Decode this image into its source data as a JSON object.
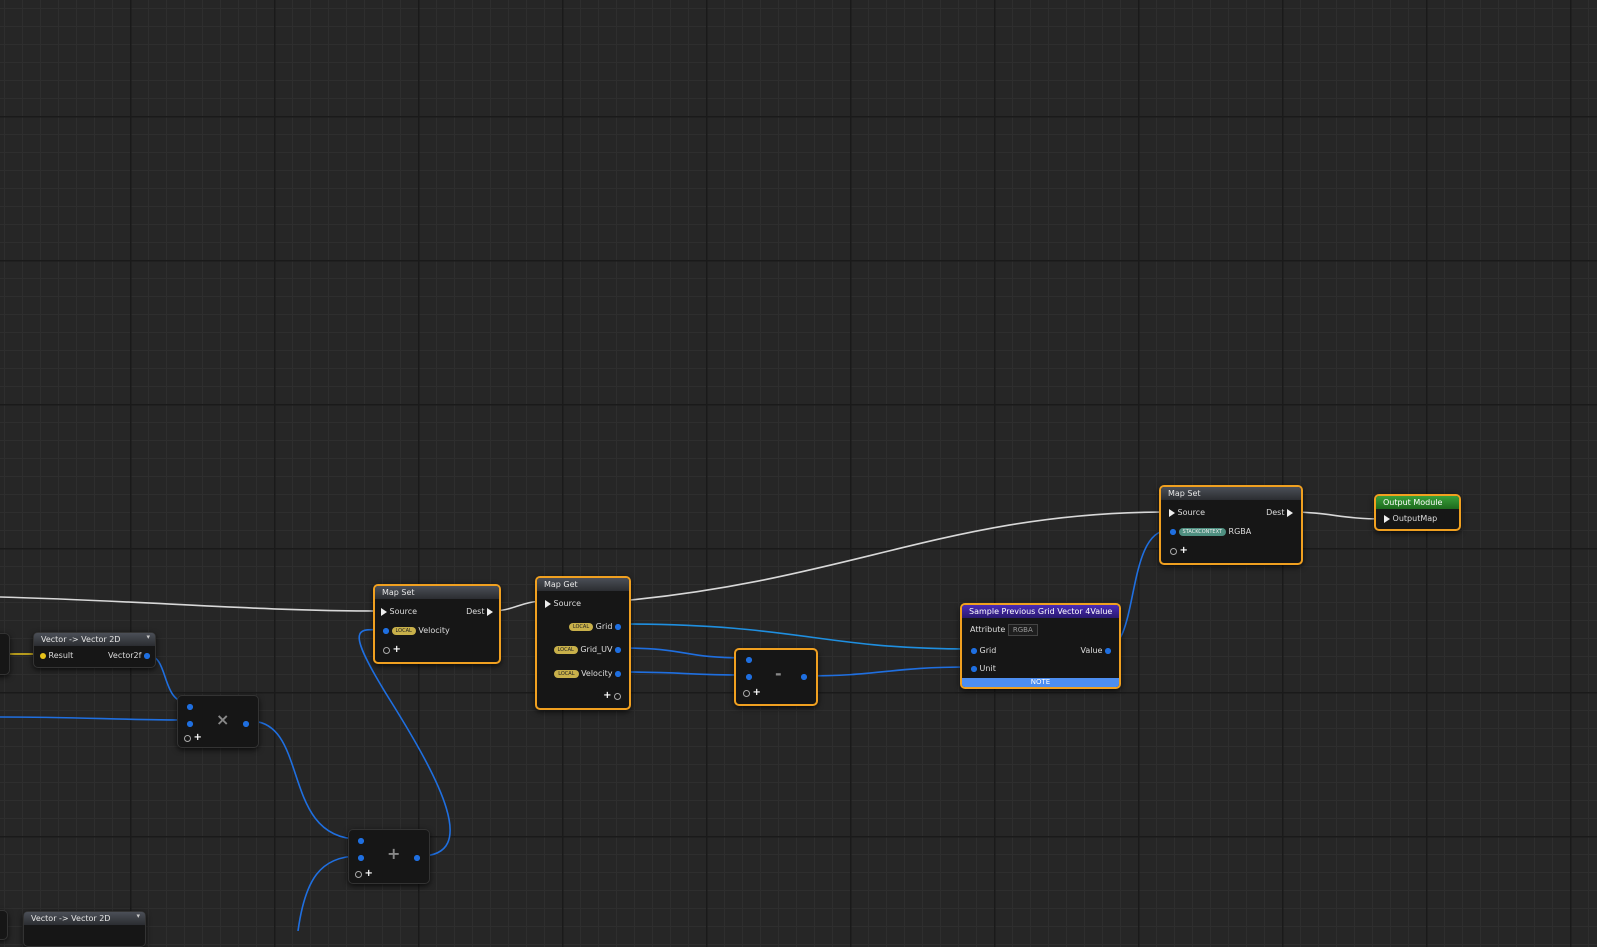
{
  "nodes": {
    "vec2d_a": {
      "title": "Vector -> Vector 2D",
      "in_label": "Result",
      "out_label": "Vector2f"
    },
    "map_set_1": {
      "title": "Map Set",
      "source": "Source",
      "dest": "Dest",
      "badge": "LOCAL",
      "param": "Velocity"
    },
    "map_get": {
      "title": "Map Get",
      "source": "Source",
      "badge": "LOCAL",
      "outputs": [
        "Grid",
        "Grid_UV",
        "Velocity"
      ]
    },
    "subtract": {
      "symbol": "-"
    },
    "sample_grid": {
      "title": "Sample Previous Grid Vector 4Value",
      "attribute_label": "Attribute",
      "attribute_value": "RGBA",
      "grid": "Grid",
      "unit": "Unit",
      "value": "Value",
      "note": "NOTE"
    },
    "map_set_2": {
      "title": "Map Set",
      "source": "Source",
      "dest": "Dest",
      "badge": "STACKCONTEXT",
      "param": "RGBA"
    },
    "output_module": {
      "title": "Output Module",
      "pin": "OutputMap"
    },
    "multiply": {
      "symbol": "×"
    },
    "add": {
      "symbol": "+"
    },
    "vec2d_b": {
      "title": "Vector -> Vector 2D"
    }
  },
  "colors": {
    "selection": "#f0a020",
    "exec_wire": "#d8d8d8",
    "vector_wire": "#1f6fe0",
    "float_wire": "#e6c21a"
  }
}
